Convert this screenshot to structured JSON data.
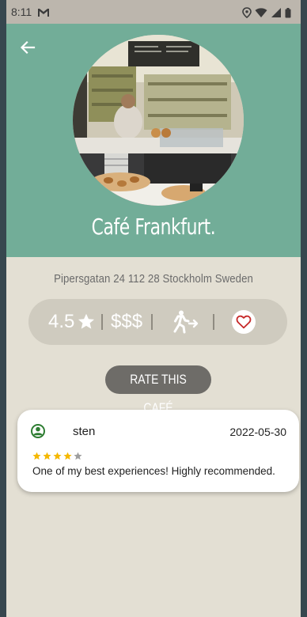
{
  "status_bar": {
    "time": "8:11",
    "icons": [
      "gmail-icon",
      "location-icon",
      "wifi-icon",
      "signal-icon",
      "battery-icon"
    ]
  },
  "header": {
    "back_icon": "arrow-left-icon",
    "cafe_name": "Café Frankfurt."
  },
  "address": "Pipersgatan 24 112 28 Stockholm Sweden",
  "info": {
    "rating": "4.5",
    "rating_icon": "star-icon",
    "price": "$$$",
    "accessibility_icon": "walking-icon",
    "favorite_icon": "heart-outline-icon"
  },
  "rate_button": "RATE THIS CAFÉ",
  "reviews": [
    {
      "user_icon": "user-avatar-icon",
      "reviewer": "sten",
      "date": "2022-05-30",
      "stars_filled": 4,
      "stars_total": 5,
      "text": "One of my best experiences! Highly recommended."
    }
  ],
  "colors": {
    "hero_background": "#72ad98",
    "page_background": "#e3dfd3",
    "star_filled": "#f5b800",
    "star_empty": "#9e9e9e",
    "heart": "#c62828",
    "avatar": "#2e7d32"
  }
}
